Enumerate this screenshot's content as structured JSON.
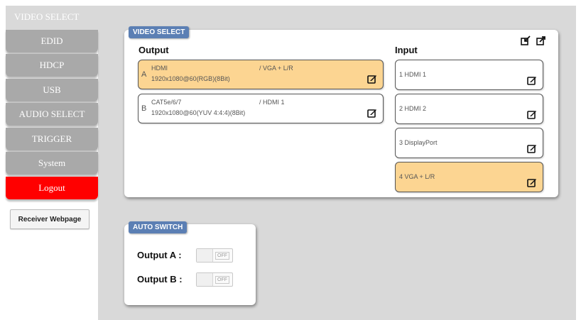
{
  "nav": {
    "active": "VIDEO SELECT",
    "items": [
      "EDID",
      "HDCP",
      "USB",
      "AUDIO SELECT",
      "TRIGGER",
      "System",
      "Logout"
    ]
  },
  "receiver_button": "Receiver Webpage",
  "video_select": {
    "tag": "VIDEO SELECT",
    "output_title": "Output",
    "input_title": "Input",
    "outputs": [
      {
        "letter": "A",
        "type": "HDMI",
        "route": "/ VGA + L/R",
        "format": "1920x1080@60(RGB)(8Bit)",
        "selected": true
      },
      {
        "letter": "B",
        "type": "CAT5e/6/7",
        "route": "/ HDMI 1",
        "format": "1920x1080@60(YUV 4:4:4)(8Bit)",
        "selected": false
      }
    ],
    "inputs": [
      {
        "label": "1  HDMI 1",
        "selected": false
      },
      {
        "label": "2  HDMI 2",
        "selected": false
      },
      {
        "label": "3  DisplayPort",
        "selected": false
      },
      {
        "label": "4  VGA + L/R",
        "selected": true
      }
    ]
  },
  "auto_switch": {
    "tag": "AUTO SWITCH",
    "rows": [
      {
        "label": "Output A :",
        "state": "OFF"
      },
      {
        "label": "Output B :",
        "state": "OFF"
      }
    ]
  },
  "colors": {
    "nav_gray": "#a9a9a9",
    "logout_red": "#ff0000",
    "selected_orange": "#fcd592",
    "tag_blue": "#5b7fb4"
  }
}
